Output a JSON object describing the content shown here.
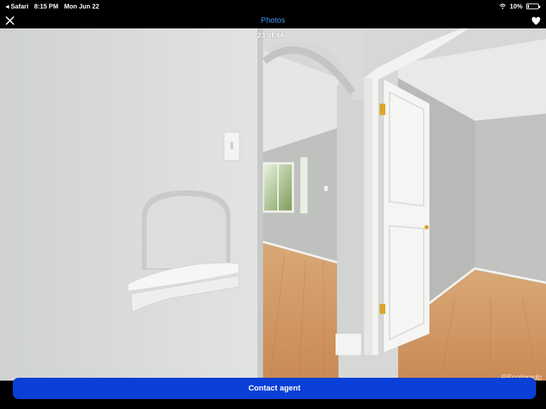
{
  "status_bar": {
    "app": "◂ Safari",
    "time": "8:15 PM",
    "date": "Mon Jun 22",
    "battery": "10%"
  },
  "nav": {
    "title": "Photos",
    "close_icon": "close-icon",
    "favorite_icon": "heart-icon"
  },
  "photo": {
    "counter": "23 of 44",
    "watermark": "REcolorado"
  },
  "actions": {
    "contact_label": "Contact agent"
  },
  "colors": {
    "accent": "#0a3fd8",
    "title": "#3f8ff0"
  }
}
